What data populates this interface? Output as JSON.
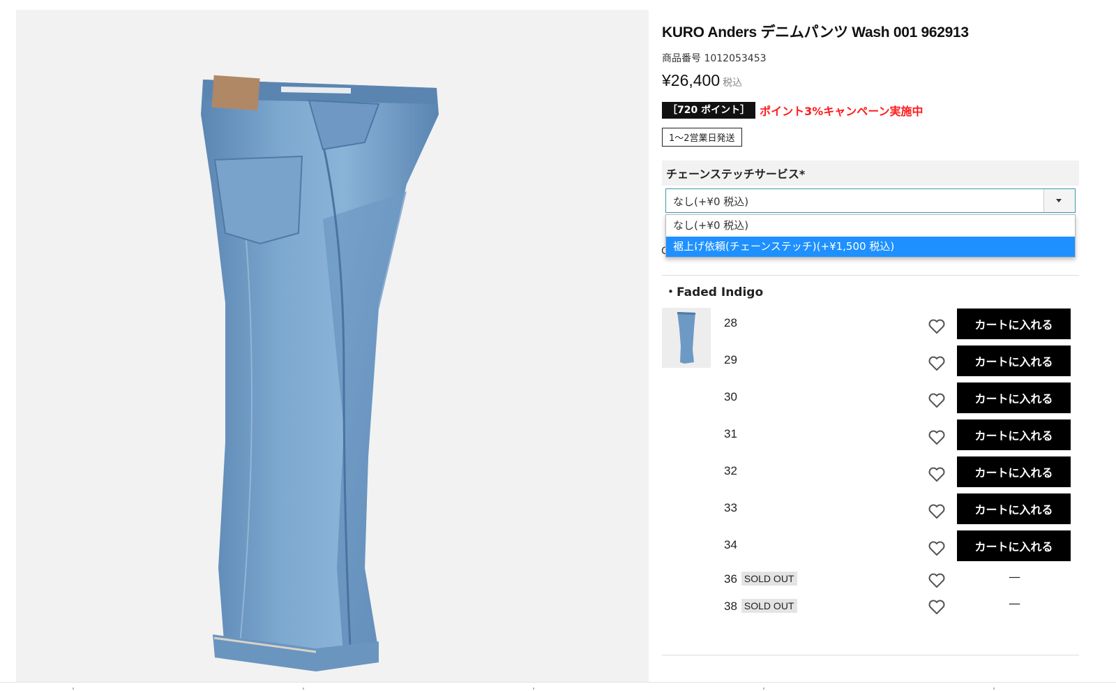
{
  "product": {
    "title": "KURO Anders デニムパンツ Wash 001 962913",
    "number": "商品番号 1012053453",
    "price": "¥26,400",
    "tax_label": "税込",
    "points_badge": "［720 ポイント］",
    "campaign": "ポイント3%キャンペーン実施中",
    "shipping": "1～2営業日発送"
  },
  "chain_stitch": {
    "label": "チェーンステッチサービス*",
    "selected": "なし(+¥0 税込)",
    "options": [
      "なし(+¥0 税込)",
      "裾上げ依頼(チェーンステッチ)(+¥1,500 税込)"
    ],
    "highlighted_index": 1,
    "peek": "C"
  },
  "color": {
    "name": "・Faded Indigo"
  },
  "sizes": [
    {
      "size": "28",
      "status": "",
      "cart_label": "カートに入れる"
    },
    {
      "size": "29",
      "status": "",
      "cart_label": "カートに入れる"
    },
    {
      "size": "30",
      "status": "",
      "cart_label": "カートに入れる"
    },
    {
      "size": "31",
      "status": "",
      "cart_label": "カートに入れる"
    },
    {
      "size": "32",
      "status": "",
      "cart_label": "カートに入れる"
    },
    {
      "size": "33",
      "status": "",
      "cart_label": "カートに入れる"
    },
    {
      "size": "34",
      "status": "",
      "cart_label": "カートに入れる"
    },
    {
      "size": "36",
      "status": "SOLD OUT",
      "cart_label": "—"
    },
    {
      "size": "38",
      "status": "SOLD OUT",
      "cart_label": "—"
    }
  ],
  "colors": {
    "campaign_red": "#ff1a1a",
    "dropdown_highlight": "#1e90ff",
    "cart_button": "#000000",
    "denim": "#6d9ac4"
  }
}
